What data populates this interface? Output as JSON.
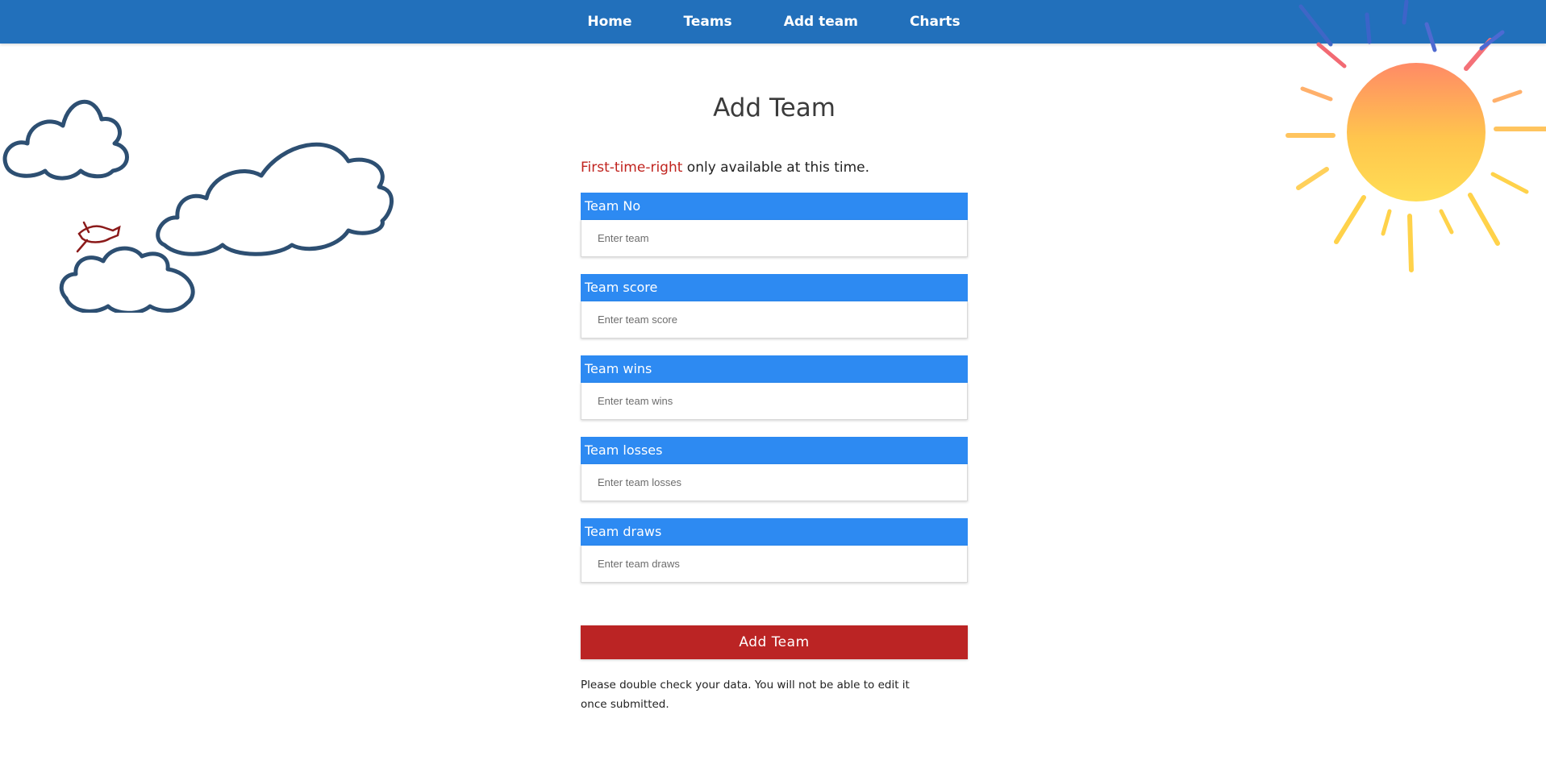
{
  "nav": {
    "items": [
      {
        "label": "Home"
      },
      {
        "label": "Teams"
      },
      {
        "label": "Add team"
      },
      {
        "label": "Charts"
      }
    ]
  },
  "page": {
    "title": "Add Team",
    "notice_highlight": "First-time-right",
    "notice_rest": " only available at this time."
  },
  "form": {
    "fields": [
      {
        "label": "Team No",
        "placeholder": "Enter team",
        "value": ""
      },
      {
        "label": "Team score",
        "placeholder": "Enter team score",
        "value": ""
      },
      {
        "label": "Team wins",
        "placeholder": "Enter team wins",
        "value": ""
      },
      {
        "label": "Team losses",
        "placeholder": "Enter team losses",
        "value": ""
      },
      {
        "label": "Team draws",
        "placeholder": "Enter team draws",
        "value": ""
      }
    ],
    "submit_label": "Add Team",
    "footnote": "Please double check your data. You will not be able to edit it once submitted."
  },
  "colors": {
    "navbar": "#2270bb",
    "field_label": "#2d8af2",
    "submit": "#bb2424",
    "highlight": "#c0231e"
  },
  "icons": {
    "decor_sun": "sun-illustration",
    "decor_clouds": "cloud-illustration",
    "decor_bird": "bird-illustration"
  }
}
